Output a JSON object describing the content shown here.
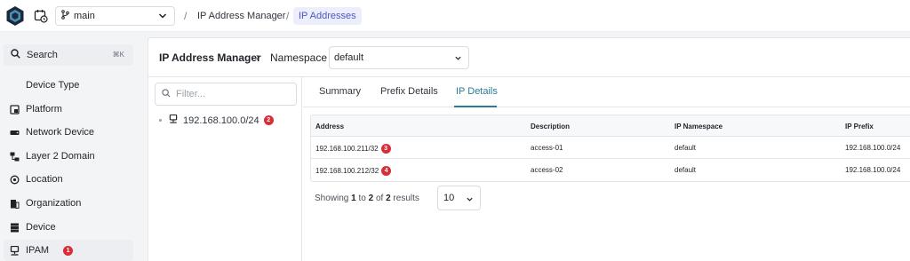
{
  "header": {
    "branch": "main",
    "breadcrumbs": [
      "IP Address Manager",
      "IP Addresses"
    ],
    "separator": "/"
  },
  "sidebar": {
    "search_label": "Search",
    "search_shortcut": "⌘K",
    "items": [
      {
        "label": "Device Type",
        "icon": "none"
      },
      {
        "label": "Platform",
        "icon": "platform-icon"
      },
      {
        "label": "Network Device",
        "icon": "network-device-icon"
      },
      {
        "label": "Layer 2 Domain",
        "icon": "layer2-icon"
      },
      {
        "label": "Location",
        "icon": "location-icon"
      },
      {
        "label": "Organization",
        "icon": "organization-icon"
      },
      {
        "label": "Device",
        "icon": "device-icon"
      },
      {
        "label": "IPAM",
        "icon": "ipam-icon",
        "badge": "1",
        "active": true
      }
    ]
  },
  "panel": {
    "title": "IP Address Manager",
    "arrow": "›",
    "namespace_label": "Namespace",
    "namespace_value": "default",
    "filter_placeholder": "Filter...",
    "tree": [
      {
        "label": "192.168.100.0/24",
        "badge": "2"
      }
    ],
    "tabs": [
      "Summary",
      "Prefix Details",
      "IP Details"
    ],
    "active_tab": "IP Details",
    "table": {
      "columns": [
        "Address",
        "Description",
        "IP Namespace",
        "IP Prefix"
      ],
      "rows": [
        {
          "address": "192.168.100.211/32",
          "badge": "3",
          "description": "access-01",
          "namespace": "default",
          "prefix": "192.168.100.0/24"
        },
        {
          "address": "192.168.100.212/32",
          "badge": "4",
          "description": "access-02",
          "namespace": "default",
          "prefix": "192.168.100.0/24"
        }
      ]
    },
    "footer": {
      "showing": "Showing",
      "from": "1",
      "to_word": "to",
      "to": "2",
      "of_word": "of",
      "total": "2",
      "results": "results"
    },
    "page_size": "10"
  },
  "colors": {
    "accent": "#2b7a9a",
    "breadcrumb_active": "#4b57c9",
    "badge": "#d92d38"
  }
}
